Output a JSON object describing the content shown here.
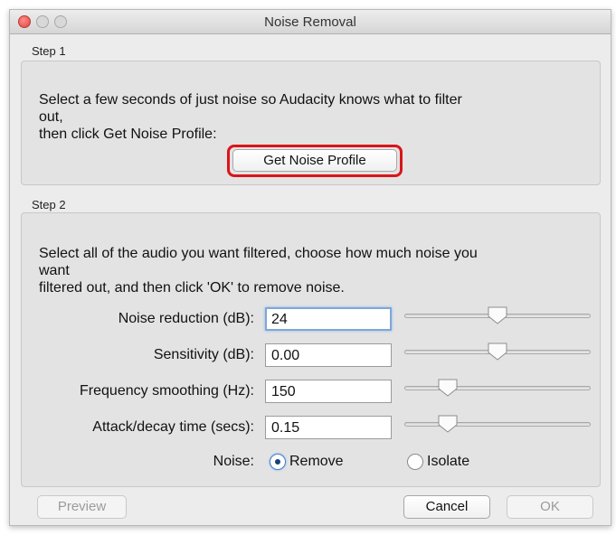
{
  "window": {
    "title": "Noise Removal"
  },
  "step1": {
    "label": "Step 1",
    "instruction_line1": "Select a few seconds of just noise so Audacity knows what to filter",
    "instruction_line2": "out,",
    "instruction_line3": "then click Get Noise Profile:",
    "get_profile_button": "Get Noise Profile"
  },
  "step2": {
    "label": "Step 2",
    "instruction_line1": "Select all of the audio you want filtered, choose how much noise you",
    "instruction_line2": "want",
    "instruction_line3": "filtered out, and then click 'OK' to remove noise.",
    "params": [
      {
        "label": "Noise reduction (dB):",
        "value": "24",
        "slider_fraction": 0.5
      },
      {
        "label": "Sensitivity (dB):",
        "value": "0.00",
        "slider_fraction": 0.5
      },
      {
        "label": "Frequency smoothing (Hz):",
        "value": "150",
        "slider_fraction": 0.2
      },
      {
        "label": "Attack/decay time (secs):",
        "value": "0.15",
        "slider_fraction": 0.2
      }
    ],
    "noise_label": "Noise:",
    "noise_options": [
      {
        "label": "Remove",
        "selected": true
      },
      {
        "label": "Isolate",
        "selected": false
      }
    ]
  },
  "buttons": {
    "preview": "Preview",
    "cancel": "Cancel",
    "ok": "OK"
  },
  "colors": {
    "highlight": "#d9151b",
    "focus": "#7ea7d8"
  }
}
